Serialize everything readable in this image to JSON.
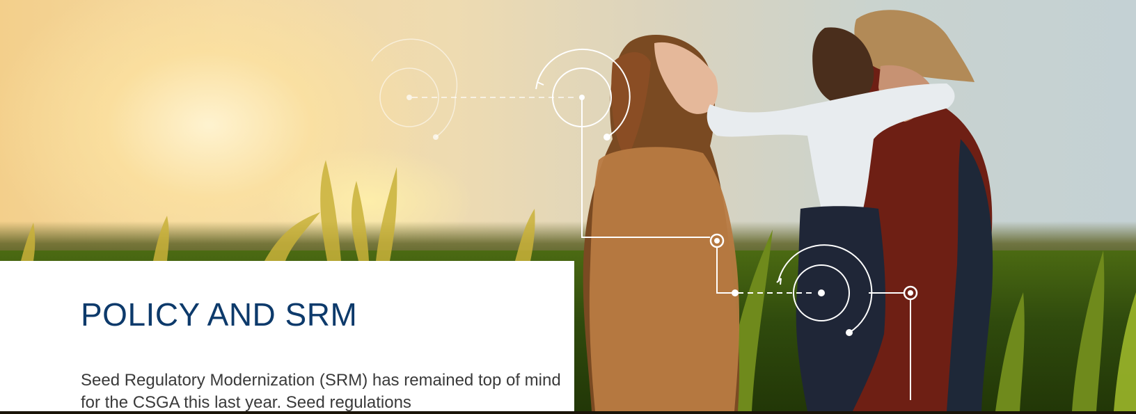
{
  "section": {
    "title": "POLICY AND SRM",
    "body": "Seed Regulatory Modernization (SRM) has remained top of mind for the CSGA this last year. Seed regulations"
  },
  "hero": {
    "image_semantic": "family-in-cornfield-at-sunset",
    "colors": {
      "title_blue": "#0d3a6b",
      "body_text": "#3a3a3a",
      "panel_bg": "#ffffff",
      "line_overlay": "#ffffff"
    }
  }
}
